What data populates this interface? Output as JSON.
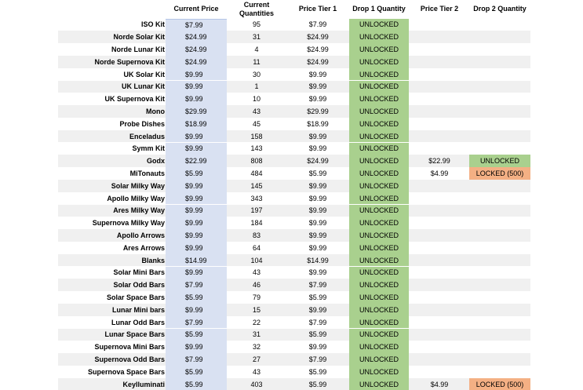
{
  "headers": {
    "current_price": "Current Price",
    "current_quantities": "Current\nQuantities",
    "price_tier_1": "Price Tier 1",
    "drop_1_quantity": "Drop 1 Quantity",
    "price_tier_2": "Price Tier 2",
    "drop_2_quantity": "Drop 2 Quantity"
  },
  "rows": [
    {
      "name": "ISO Kit",
      "current_price": "$7.99",
      "quantity": "95",
      "price_tier_1": "$7.99",
      "drop_1": "UNLOCKED",
      "price_tier_2": "",
      "drop_2": ""
    },
    {
      "name": "Norde Solar Kit",
      "current_price": "$24.99",
      "quantity": "31",
      "price_tier_1": "$24.99",
      "drop_1": "UNLOCKED",
      "price_tier_2": "",
      "drop_2": ""
    },
    {
      "name": "Norde Lunar Kit",
      "current_price": "$24.99",
      "quantity": "4",
      "price_tier_1": "$24.99",
      "drop_1": "UNLOCKED",
      "price_tier_2": "",
      "drop_2": ""
    },
    {
      "name": "Norde Supernova Kit",
      "current_price": "$24.99",
      "quantity": "11",
      "price_tier_1": "$24.99",
      "drop_1": "UNLOCKED",
      "price_tier_2": "",
      "drop_2": ""
    },
    {
      "name": "UK Solar Kit",
      "current_price": "$9.99",
      "quantity": "30",
      "price_tier_1": "$9.99",
      "drop_1": "UNLOCKED",
      "price_tier_2": "",
      "drop_2": ""
    },
    {
      "name": "UK Lunar Kit",
      "current_price": "$9.99",
      "quantity": "1",
      "price_tier_1": "$9.99",
      "drop_1": "UNLOCKED",
      "price_tier_2": "",
      "drop_2": ""
    },
    {
      "name": "UK Supernova Kit",
      "current_price": "$9.99",
      "quantity": "10",
      "price_tier_1": "$9.99",
      "drop_1": "UNLOCKED",
      "price_tier_2": "",
      "drop_2": ""
    },
    {
      "name": "Mono",
      "current_price": "$29.99",
      "quantity": "43",
      "price_tier_1": "$29.99",
      "drop_1": "UNLOCKED",
      "price_tier_2": "",
      "drop_2": ""
    },
    {
      "name": "Probe Dishes",
      "current_price": "$18.99",
      "quantity": "45",
      "price_tier_1": "$18.99",
      "drop_1": "UNLOCKED",
      "price_tier_2": "",
      "drop_2": ""
    },
    {
      "name": "Enceladus",
      "current_price": "$9.99",
      "quantity": "158",
      "price_tier_1": "$9.99",
      "drop_1": "UNLOCKED",
      "price_tier_2": "",
      "drop_2": ""
    },
    {
      "name": "Symm Kit",
      "current_price": "$9.99",
      "quantity": "143",
      "price_tier_1": "$9.99",
      "drop_1": "UNLOCKED",
      "price_tier_2": "",
      "drop_2": ""
    },
    {
      "name": "Godx",
      "current_price": "$22.99",
      "quantity": "808",
      "price_tier_1": "$24.99",
      "drop_1": "UNLOCKED",
      "price_tier_2": "$22.99",
      "drop_2": "UNLOCKED"
    },
    {
      "name": "MiTonauts",
      "current_price": "$5.99",
      "quantity": "484",
      "price_tier_1": "$5.99",
      "drop_1": "UNLOCKED",
      "price_tier_2": "$4.99",
      "drop_2": "LOCKED (500)"
    },
    {
      "name": "Solar Milky Way",
      "current_price": "$9.99",
      "quantity": "145",
      "price_tier_1": "$9.99",
      "drop_1": "UNLOCKED",
      "price_tier_2": "",
      "drop_2": ""
    },
    {
      "name": "Apollo Milky Way",
      "current_price": "$9.99",
      "quantity": "343",
      "price_tier_1": "$9.99",
      "drop_1": "UNLOCKED",
      "price_tier_2": "",
      "drop_2": ""
    },
    {
      "name": "Ares Milky Way",
      "current_price": "$9.99",
      "quantity": "197",
      "price_tier_1": "$9.99",
      "drop_1": "UNLOCKED",
      "price_tier_2": "",
      "drop_2": ""
    },
    {
      "name": "Supernova Milky Way",
      "current_price": "$9.99",
      "quantity": "184",
      "price_tier_1": "$9.99",
      "drop_1": "UNLOCKED",
      "price_tier_2": "",
      "drop_2": ""
    },
    {
      "name": "Apollo Arrows",
      "current_price": "$9.99",
      "quantity": "83",
      "price_tier_1": "$9.99",
      "drop_1": "UNLOCKED",
      "price_tier_2": "",
      "drop_2": ""
    },
    {
      "name": "Ares Arrows",
      "current_price": "$9.99",
      "quantity": "64",
      "price_tier_1": "$9.99",
      "drop_1": "UNLOCKED",
      "price_tier_2": "",
      "drop_2": ""
    },
    {
      "name": "Blanks",
      "current_price": "$14.99",
      "quantity": "104",
      "price_tier_1": "$14.99",
      "drop_1": "UNLOCKED",
      "price_tier_2": "",
      "drop_2": ""
    },
    {
      "name": "Solar Mini Bars",
      "current_price": "$9.99",
      "quantity": "43",
      "price_tier_1": "$9.99",
      "drop_1": "UNLOCKED",
      "price_tier_2": "",
      "drop_2": ""
    },
    {
      "name": "Solar Odd Bars",
      "current_price": "$7.99",
      "quantity": "46",
      "price_tier_1": "$7.99",
      "drop_1": "UNLOCKED",
      "price_tier_2": "",
      "drop_2": ""
    },
    {
      "name": "Solar Space Bars",
      "current_price": "$5.99",
      "quantity": "79",
      "price_tier_1": "$5.99",
      "drop_1": "UNLOCKED",
      "price_tier_2": "",
      "drop_2": ""
    },
    {
      "name": "Lunar Mini bars",
      "current_price": "$9.99",
      "quantity": "15",
      "price_tier_1": "$9.99",
      "drop_1": "UNLOCKED",
      "price_tier_2": "",
      "drop_2": ""
    },
    {
      "name": "Lunar Odd Bars",
      "current_price": "$7.99",
      "quantity": "22",
      "price_tier_1": "$7.99",
      "drop_1": "UNLOCKED",
      "price_tier_2": "",
      "drop_2": ""
    },
    {
      "name": "Lunar Space Bars",
      "current_price": "$5.99",
      "quantity": "31",
      "price_tier_1": "$5.99",
      "drop_1": "UNLOCKED",
      "price_tier_2": "",
      "drop_2": ""
    },
    {
      "name": "Supernova Mini Bars",
      "current_price": "$9.99",
      "quantity": "32",
      "price_tier_1": "$9.99",
      "drop_1": "UNLOCKED",
      "price_tier_2": "",
      "drop_2": ""
    },
    {
      "name": "Supernova Odd Bars",
      "current_price": "$7.99",
      "quantity": "27",
      "price_tier_1": "$7.99",
      "drop_1": "UNLOCKED",
      "price_tier_2": "",
      "drop_2": ""
    },
    {
      "name": "Supernova Space Bars",
      "current_price": "$5.99",
      "quantity": "43",
      "price_tier_1": "$5.99",
      "drop_1": "UNLOCKED",
      "price_tier_2": "",
      "drop_2": ""
    },
    {
      "name": "Keylluminati",
      "current_price": "$5.99",
      "quantity": "403",
      "price_tier_1": "$5.99",
      "drop_1": "UNLOCKED",
      "price_tier_2": "$4.99",
      "drop_2": "LOCKED (500)"
    }
  ],
  "colors": {
    "current_price_fill": "#d9e1f2",
    "unlocked_fill": "#a9d08e",
    "locked_fill": "#f4b084",
    "band_fill": "#f0f0f0"
  }
}
